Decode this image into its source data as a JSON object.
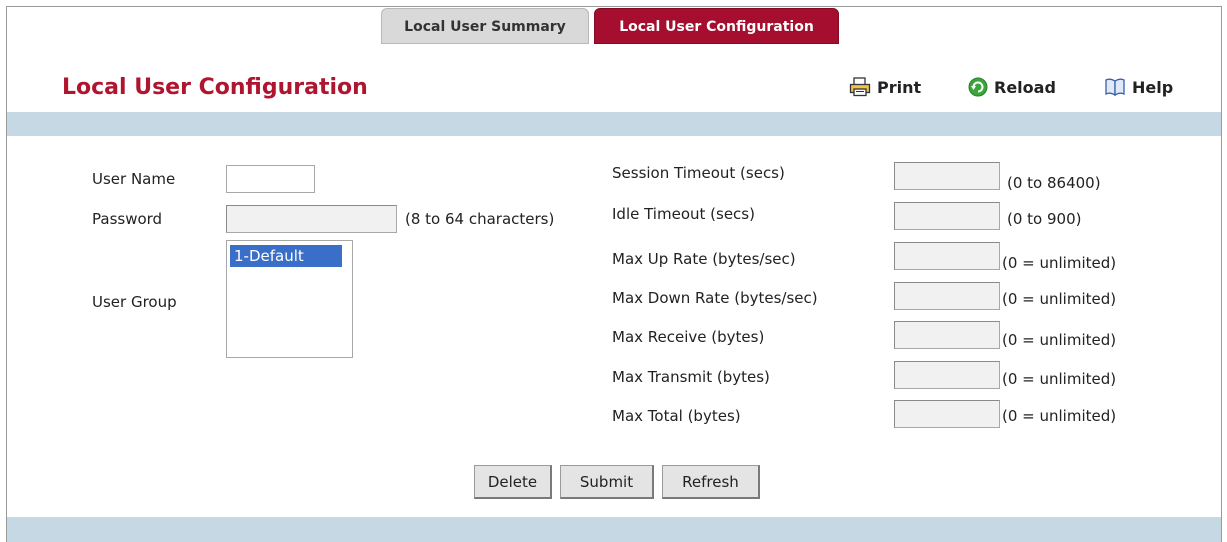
{
  "tabs": [
    {
      "label": "Local User Summary",
      "active": false
    },
    {
      "label": "Local User Configuration",
      "active": true
    }
  ],
  "header": {
    "title": "Local User Configuration",
    "print_label": "Print",
    "reload_label": "Reload",
    "help_label": "Help"
  },
  "form_left": {
    "user_name_label": "User Name",
    "user_name_value": "",
    "password_label": "Password",
    "password_value": "",
    "password_hint": "(8 to 64 characters)",
    "user_group_label": "User Group",
    "user_group_options": [
      "1-Default"
    ],
    "user_group_selected": "1-Default"
  },
  "form_right": [
    {
      "label": "Session Timeout (secs)",
      "value": "",
      "hint": "(0 to 86400)"
    },
    {
      "label": "Idle Timeout (secs)",
      "value": "",
      "hint": "(0 to 900)"
    },
    {
      "label": "Max Up Rate (bytes/sec)",
      "value": "",
      "hint": "(0 = unlimited)"
    },
    {
      "label": "Max Down Rate (bytes/sec)",
      "value": "",
      "hint": "(0 = unlimited)"
    },
    {
      "label": "Max Receive (bytes)",
      "value": "",
      "hint": "(0 = unlimited)"
    },
    {
      "label": "Max Transmit (bytes)",
      "value": "",
      "hint": "(0 = unlimited)"
    },
    {
      "label": "Max Total (bytes)",
      "value": "",
      "hint": "(0 = unlimited)"
    }
  ],
  "buttons": {
    "delete": "Delete",
    "submit": "Submit",
    "refresh": "Refresh"
  },
  "colors": {
    "accent": "#b01530",
    "active_tab": "#a50e2e",
    "band": "#c6d8e4",
    "selection": "#3a6fc9"
  },
  "icons": {
    "print": "printer-icon",
    "reload": "reload-icon",
    "help": "help-book-icon"
  }
}
